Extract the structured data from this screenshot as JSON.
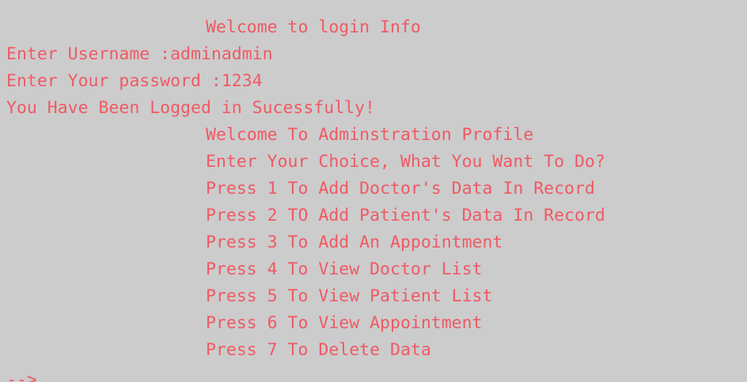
{
  "console": {
    "text_color": "#ef5a64",
    "background_color": "#cccccc",
    "lines": [
      "Welcome to login Info",
      "Enter Username :adminadmin",
      "Enter Your password :1234",
      "You Have Been Logged in Sucessfully!",
      "Welcome To Adminstration Profile",
      "Enter Your Choice, What You Want To Do?",
      "Press 1 To Add Doctor's Data In Record",
      "Press 2 TO Add Patient's Data In Record",
      "Press 3 To Add An Appointment",
      "Press 4 To View Doctor List",
      "Press 5 To View Patient List",
      "Press 6 To View Appointment",
      "Press 7 To Delete Data",
      "-->"
    ]
  }
}
